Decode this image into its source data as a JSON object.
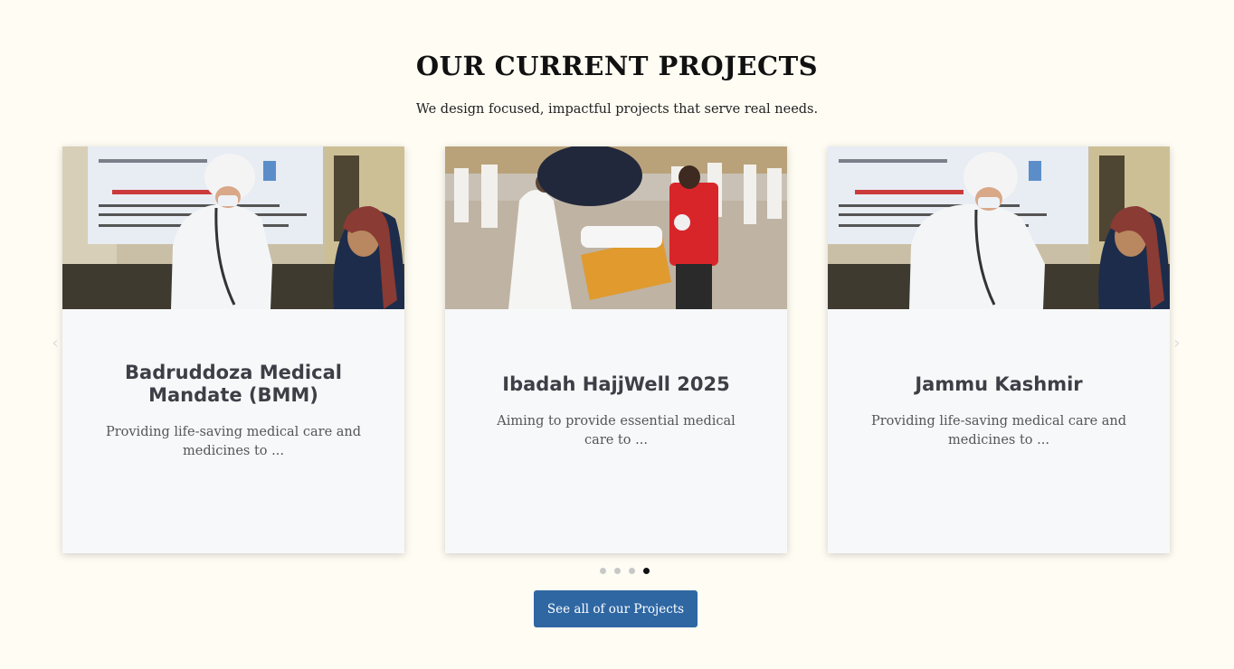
{
  "section": {
    "title": "OUR CURRENT PROJECTS",
    "subtitle": "We design focused, impactful projects that serve real needs."
  },
  "carousel": {
    "prev_arrow": "‹",
    "next_arrow": "›",
    "cards": [
      {
        "title": "Badruddoza Medical Mandate (BMM)",
        "text": "Providing life-saving medical care and medicines to ...",
        "image": "nurse-checking-patient-photo"
      },
      {
        "title": "Ibadah HajjWell 2025",
        "text": "Aiming to provide essential medical care to ...",
        "image": "hajj-stretcher-rescue-photo"
      },
      {
        "title": "Jammu Kashmir",
        "text": "Providing life-saving medical care and medicines to ...",
        "image": "nurse-checking-patient-photo"
      }
    ],
    "dots_count": 4,
    "active_dot": 4
  },
  "cta": {
    "label": "See all of our Projects",
    "color": "#2f67a3"
  },
  "colors": {
    "background": "#fffcf3",
    "card_bg": "#f7f8f9",
    "title_text": "#3d3f47"
  }
}
